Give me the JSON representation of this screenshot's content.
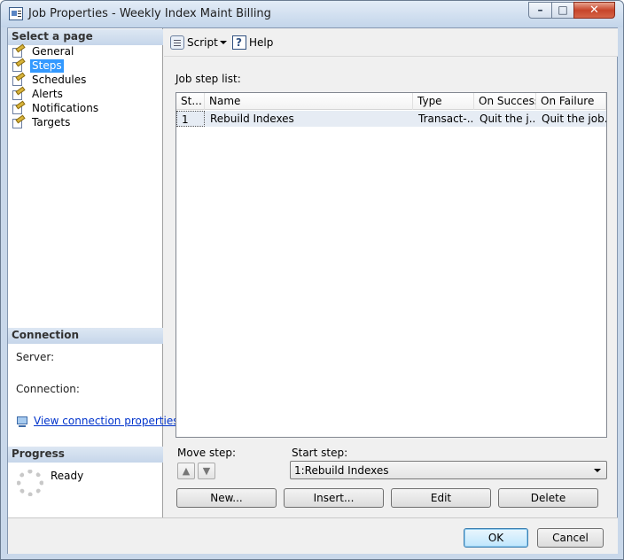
{
  "window": {
    "title": "Job Properties - Weekly Index Maint Billing",
    "min_glyph": "–",
    "max_glyph": "□",
    "close_glyph": "✕"
  },
  "left_panel": {
    "select_page_title": "Select a page",
    "pages": [
      {
        "label": "General",
        "icon": "wrench-page-icon"
      },
      {
        "label": "Steps",
        "icon": "wrench-page-icon",
        "selected": true
      },
      {
        "label": "Schedules",
        "icon": "wrench-page-icon"
      },
      {
        "label": "Alerts",
        "icon": "wrench-page-icon"
      },
      {
        "label": "Notifications",
        "icon": "wrench-page-icon"
      },
      {
        "label": "Targets",
        "icon": "wrench-page-icon"
      }
    ],
    "connection": {
      "title": "Connection",
      "server_label": "Server:",
      "connection_label": "Connection:",
      "link_text": "View connection properties"
    },
    "progress": {
      "title": "Progress",
      "status": "Ready"
    }
  },
  "toolbar": {
    "script_label": "Script",
    "help_label": "Help"
  },
  "main": {
    "job_step_list_label": "Job step list:",
    "columns": [
      "St...",
      "Name",
      "Type",
      "On Success",
      "On Failure"
    ],
    "rows": [
      {
        "step": "1",
        "name": "Rebuild Indexes",
        "type": "Transact-...",
        "on_success": "Quit the j...",
        "on_failure": "Quit the job..."
      }
    ],
    "move_step_label": "Move step:",
    "move_up_glyph": "▲",
    "move_down_glyph": "▼",
    "start_step_label": "Start step:",
    "start_step_value": "1:Rebuild Indexes",
    "buttons": {
      "new": "New...",
      "insert": "Insert...",
      "edit": "Edit",
      "delete": "Delete"
    }
  },
  "footer": {
    "ok": "OK",
    "cancel": "Cancel"
  },
  "colors": {
    "selection": "#3399ff",
    "section_header": "#c6d6ea",
    "link": "#0033cc"
  }
}
